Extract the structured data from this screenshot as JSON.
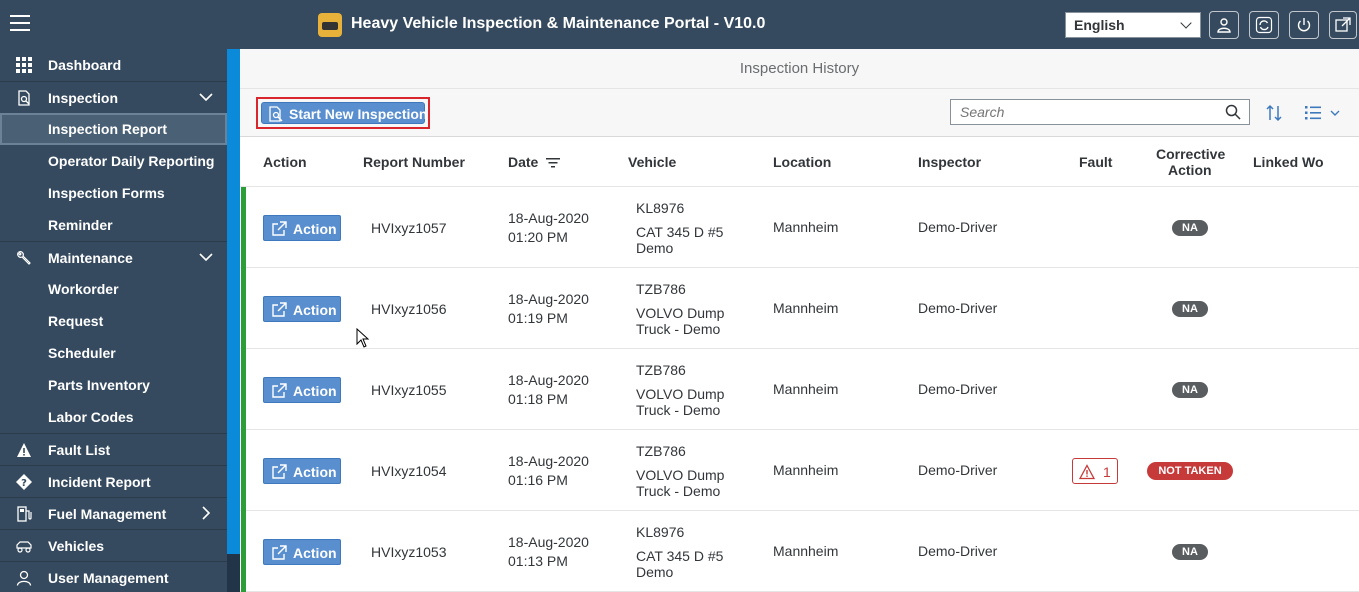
{
  "header": {
    "title": "Heavy Vehicle Inspection & Maintenance Portal - V10.0",
    "language": "English"
  },
  "sidebar": {
    "items": [
      {
        "label": "Dashboard",
        "icon": "grid-icon"
      },
      {
        "label": "Inspection",
        "icon": "inspection-icon"
      },
      {
        "label": "Inspection Report"
      },
      {
        "label": "Operator Daily Reporting"
      },
      {
        "label": "Inspection Forms"
      },
      {
        "label": "Reminder"
      },
      {
        "label": "Maintenance",
        "icon": "wrench-icon"
      },
      {
        "label": "Workorder"
      },
      {
        "label": "Request"
      },
      {
        "label": "Scheduler"
      },
      {
        "label": "Parts Inventory"
      },
      {
        "label": "Labor Codes"
      },
      {
        "label": "Fault List",
        "icon": "warning-icon"
      },
      {
        "label": "Incident Report",
        "icon": "question-diamond-icon"
      },
      {
        "label": "Fuel Management",
        "icon": "fuel-icon"
      },
      {
        "label": "Vehicles",
        "icon": "vehicles-icon"
      },
      {
        "label": "User Management",
        "icon": "user-icon"
      }
    ]
  },
  "page": {
    "title": "Inspection History",
    "start_button": "Start New Inspection",
    "search_placeholder": "Search"
  },
  "table": {
    "headers": {
      "action": "Action",
      "report_number": "Report Number",
      "date": "Date",
      "vehicle": "Vehicle",
      "location": "Location",
      "inspector": "Inspector",
      "fault": "Fault",
      "corrective_action_1": "Corrective",
      "corrective_action_2": "Action",
      "linked_wo": "Linked Wo"
    },
    "rows": [
      {
        "action": "Action",
        "report": "HVIxyz1057",
        "date": "18-Aug-2020",
        "time": "01:20 PM",
        "vehicle_id": "KL8976",
        "vehicle_name1": "CAT 345 D #5",
        "vehicle_name2": "Demo",
        "location": "Mannheim",
        "inspector": "Demo-Driver",
        "fault": "",
        "corrective": "NA"
      },
      {
        "action": "Action",
        "report": "HVIxyz1056",
        "date": "18-Aug-2020",
        "time": "01:19 PM",
        "vehicle_id": "TZB786",
        "vehicle_name1": "VOLVO Dump",
        "vehicle_name2": "Truck - Demo",
        "location": "Mannheim",
        "inspector": "Demo-Driver",
        "fault": "",
        "corrective": "NA"
      },
      {
        "action": "Action",
        "report": "HVIxyz1055",
        "date": "18-Aug-2020",
        "time": "01:18 PM",
        "vehicle_id": "TZB786",
        "vehicle_name1": "VOLVO Dump",
        "vehicle_name2": "Truck - Demo",
        "location": "Mannheim",
        "inspector": "Demo-Driver",
        "fault": "",
        "corrective": "NA"
      },
      {
        "action": "Action",
        "report": "HVIxyz1054",
        "date": "18-Aug-2020",
        "time": "01:16 PM",
        "vehicle_id": "TZB786",
        "vehicle_name1": "VOLVO Dump",
        "vehicle_name2": "Truck - Demo",
        "location": "Mannheim",
        "inspector": "Demo-Driver",
        "fault": "1",
        "corrective": "NOT TAKEN"
      },
      {
        "action": "Action",
        "report": "HVIxyz1053",
        "date": "18-Aug-2020",
        "time": "01:13 PM",
        "vehicle_id": "KL8976",
        "vehicle_name1": "CAT 345 D #5",
        "vehicle_name2": "Demo",
        "location": "Mannheim",
        "inspector": "Demo-Driver",
        "fault": "",
        "corrective": "NA"
      }
    ]
  },
  "colors": {
    "shell": "#354a5f",
    "accent": "#0a8ad9",
    "button": "#5a8fcf",
    "status_ok": "#2b9e3a",
    "alert": "#c63a3a"
  }
}
